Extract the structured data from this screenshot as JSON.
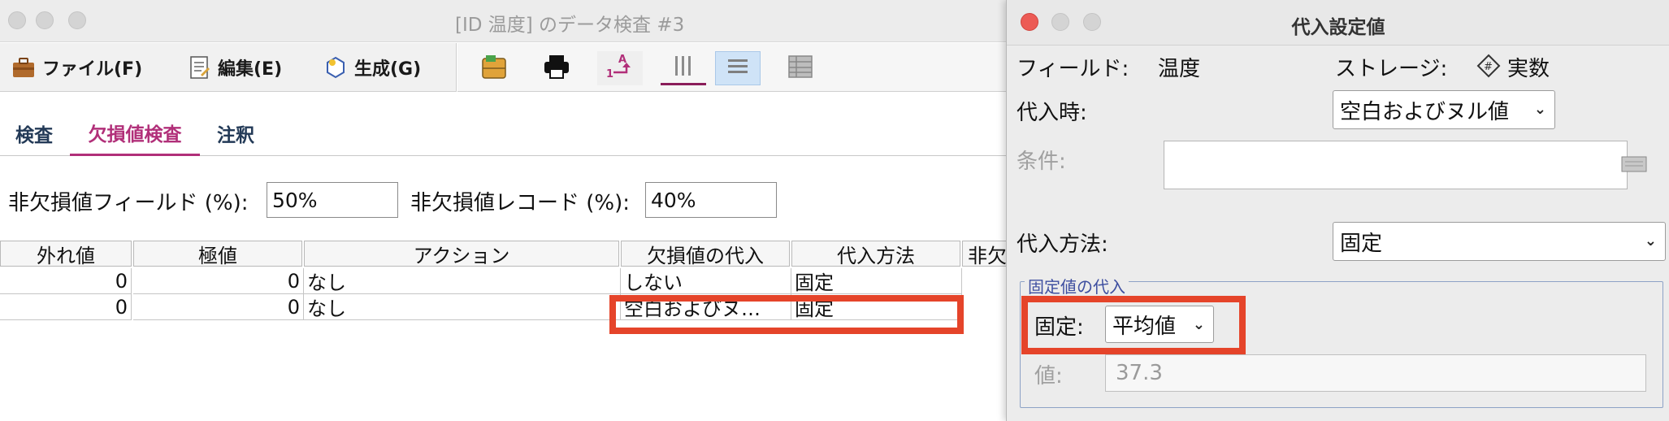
{
  "main": {
    "window_title": "[ID 温度] のデータ検査 #3",
    "menu": [
      {
        "label": "ファイル(F)",
        "icon": "briefcase-icon"
      },
      {
        "label": "編集(E)",
        "icon": "document-icon"
      },
      {
        "label": "生成(G)",
        "icon": "wand-icon"
      }
    ],
    "toolbar_icons": [
      "node-icon",
      "print-icon",
      "sort-icon",
      "columns-icon",
      "rows-icon",
      "table-icon"
    ],
    "tabs": [
      "検査",
      "欠損値検査",
      "注釈"
    ],
    "active_tab": "欠損値検査",
    "fields": {
      "non_missing_fields_label": "非欠損値フィールド (%):",
      "non_missing_fields_value": "50%",
      "non_missing_records_label": "非欠損値レコード (%):",
      "non_missing_records_value": "40%"
    },
    "grid": {
      "columns": [
        "外れ値",
        "極値",
        "アクション",
        "欠損値の代入",
        "代入方法",
        "非欠"
      ],
      "rows": [
        [
          "0",
          "0",
          "なし",
          "しない",
          "固定"
        ],
        [
          "0",
          "0",
          "なし",
          "空白およびヌ…",
          "固定"
        ]
      ]
    }
  },
  "dialog": {
    "title": "代入設定値",
    "field_label": "フィールド:",
    "field_value": "温度",
    "storage_label": "ストレージ:",
    "storage_value": "実数",
    "impute_when_label": "代入時:",
    "impute_when_value": "空白およびヌル値",
    "condition_label": "条件:",
    "method_label": "代入方法:",
    "method_value": "固定",
    "fixed_group_legend": "固定値の代入",
    "fixed_label": "固定:",
    "fixed_value": "平均値",
    "value_label": "値:",
    "value_value": "37.3"
  },
  "colors": {
    "highlight": "#e5442a",
    "active_tab": "#b12f79",
    "legend": "#3e4fa0"
  }
}
